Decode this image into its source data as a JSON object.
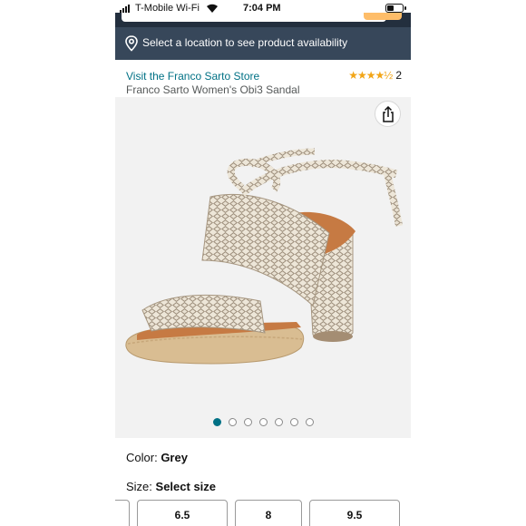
{
  "status_bar": {
    "carrier": "T-Mobile Wi-Fi",
    "time": "7:04 PM"
  },
  "location_bar": {
    "text": "Select a location to see product availability",
    "icon": "location-pin-icon"
  },
  "product": {
    "store_link": "Visit the Franco Sarto Store",
    "rating_stars": "★★★★½",
    "rating_value": 4.5,
    "rating_count": "2",
    "title": "Franco Sarto Women's Obi3 Sandal",
    "share_icon": "share-icon"
  },
  "gallery": {
    "image_count": 7,
    "active_index": 0
  },
  "color": {
    "label": "Color:",
    "value": "Grey"
  },
  "size": {
    "label": "Size:",
    "value": "Select size",
    "options": [
      "",
      "6.5",
      "8",
      "9.5"
    ]
  },
  "colors": {
    "link": "#007185",
    "star": "#f2a516",
    "location_bar_bg": "#37475a",
    "header_bg": "#232f3e"
  }
}
